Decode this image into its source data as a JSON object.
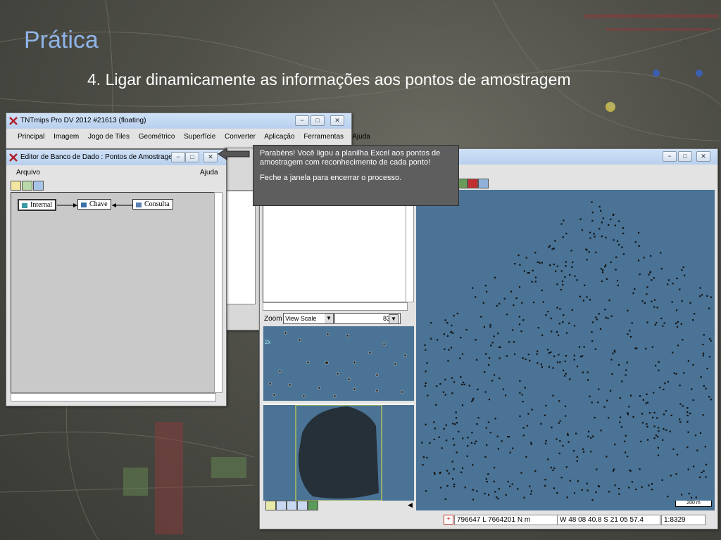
{
  "slide": {
    "title": "Prática",
    "subtitle": "4. Ligar dinamicamente as informações aos pontos de amostragem"
  },
  "main_window": {
    "title": "TNTmips Pro DV 2012  #21613 (floating)",
    "menu": [
      "Principal",
      "Imagem",
      "Jogo de Tiles",
      "Geométrico",
      "Superfície",
      "Converter",
      "Aplicação",
      "Ferramentas",
      "Ajuda"
    ]
  },
  "db_editor": {
    "title": "Editor de Banco de Dado : Pontos de Amostrage...",
    "menu_left": "Arquivo",
    "menu_right": "Ajuda",
    "nodes": [
      "Internal",
      "Chave",
      "Consulta"
    ]
  },
  "tooltip": {
    "line1": "Parabéns! Você ligou a planilha Excel aos pontos de amostragem com reconhecimento de cada ponto!",
    "line2": "Feche a janela para encerrar o processo."
  },
  "view_window": {
    "zoom_label": "Zoom",
    "zoom_select": "View Scale",
    "zoom_value": "8329",
    "zoom_2x": "2x",
    "scale_bar": "200 m",
    "status_coords": "796647 L  7664201 N m",
    "status_latlon": "W 48 08 40.8  S 21 05 57.4",
    "status_scale": "1:8329"
  },
  "colors": {
    "map_bg": "#4a7395",
    "accent_title": "#8fb4e6",
    "tooltip_bg": "#5e5e5e"
  }
}
